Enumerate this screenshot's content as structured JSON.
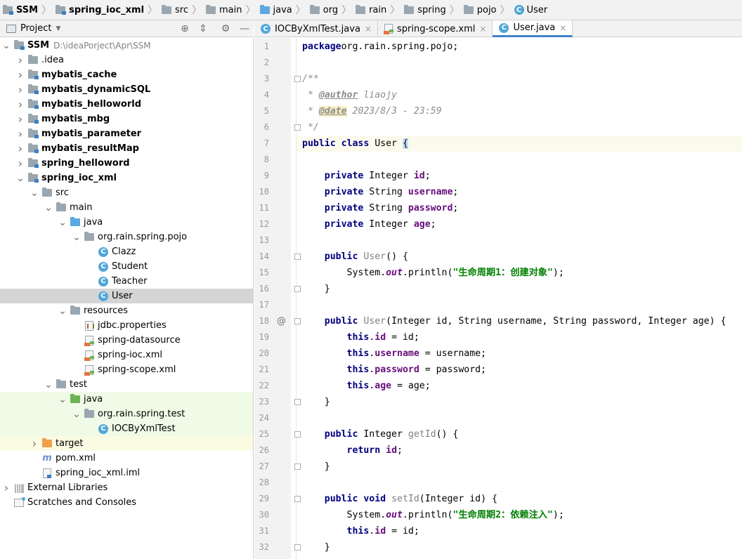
{
  "breadcrumb": [
    {
      "label": "SSM",
      "icon": "module-folder-icon",
      "bold": true
    },
    {
      "label": "spring_ioc_xml",
      "icon": "module-folder-icon",
      "bold": true
    },
    {
      "label": "src",
      "icon": "folder-icon",
      "bold": false
    },
    {
      "label": "main",
      "icon": "folder-icon",
      "bold": false
    },
    {
      "label": "java",
      "icon": "source-folder-icon",
      "bold": false
    },
    {
      "label": "org",
      "icon": "package-icon",
      "bold": false
    },
    {
      "label": "rain",
      "icon": "package-icon",
      "bold": false
    },
    {
      "label": "spring",
      "icon": "package-icon",
      "bold": false
    },
    {
      "label": "pojo",
      "icon": "package-icon",
      "bold": false
    },
    {
      "label": "User",
      "icon": "class-icon",
      "bold": false
    }
  ],
  "project_panel": {
    "title": "Project",
    "tree": [
      {
        "depth": 0,
        "label": "SSM",
        "hint": "D:\\ideaPorject\\Apr\\SSM",
        "icon": "module",
        "arrow": "down",
        "bold": true
      },
      {
        "depth": 1,
        "label": ".idea",
        "icon": "folder",
        "arrow": "right",
        "bold": false
      },
      {
        "depth": 1,
        "label": "mybatis_cache",
        "icon": "module",
        "arrow": "right",
        "bold": true
      },
      {
        "depth": 1,
        "label": "mybatis_dynamicSQL",
        "icon": "module",
        "arrow": "right",
        "bold": true
      },
      {
        "depth": 1,
        "label": "mybatis_helloworld",
        "icon": "module",
        "arrow": "right",
        "bold": true
      },
      {
        "depth": 1,
        "label": "mybatis_mbg",
        "icon": "module",
        "arrow": "right",
        "bold": true
      },
      {
        "depth": 1,
        "label": "mybatis_parameter",
        "icon": "module",
        "arrow": "right",
        "bold": true
      },
      {
        "depth": 1,
        "label": "mybatis_resultMap",
        "icon": "module",
        "arrow": "right",
        "bold": true
      },
      {
        "depth": 1,
        "label": "spring_helloword",
        "icon": "module",
        "arrow": "right",
        "bold": true
      },
      {
        "depth": 1,
        "label": "spring_ioc_xml",
        "icon": "module",
        "arrow": "down",
        "bold": true
      },
      {
        "depth": 2,
        "label": "src",
        "icon": "folder",
        "arrow": "down",
        "bold": false
      },
      {
        "depth": 3,
        "label": "main",
        "icon": "folder",
        "arrow": "down",
        "bold": false
      },
      {
        "depth": 4,
        "label": "java",
        "icon": "source",
        "arrow": "down",
        "bold": false
      },
      {
        "depth": 5,
        "label": "org.rain.spring.pojo",
        "icon": "package",
        "arrow": "down",
        "bold": false
      },
      {
        "depth": 6,
        "label": "Clazz",
        "icon": "class",
        "arrow": "",
        "bold": false
      },
      {
        "depth": 6,
        "label": "Student",
        "icon": "class",
        "arrow": "",
        "bold": false
      },
      {
        "depth": 6,
        "label": "Teacher",
        "icon": "class",
        "arrow": "",
        "bold": false
      },
      {
        "depth": 6,
        "label": "User",
        "icon": "class",
        "arrow": "",
        "bold": false,
        "selected": true
      },
      {
        "depth": 4,
        "label": "resources",
        "icon": "resources",
        "arrow": "down",
        "bold": false
      },
      {
        "depth": 5,
        "label": "jdbc.properties",
        "icon": "prop",
        "arrow": "",
        "bold": false
      },
      {
        "depth": 5,
        "label": "spring-datasource",
        "icon": "xml",
        "arrow": "",
        "bold": false
      },
      {
        "depth": 5,
        "label": "spring-ioc.xml",
        "icon": "xml",
        "arrow": "",
        "bold": false
      },
      {
        "depth": 5,
        "label": "spring-scope.xml",
        "icon": "xml",
        "arrow": "",
        "bold": false
      },
      {
        "depth": 3,
        "label": "test",
        "icon": "folder",
        "arrow": "down",
        "bold": false
      },
      {
        "depth": 4,
        "label": "java",
        "icon": "testsource",
        "arrow": "down",
        "bold": false,
        "test": true
      },
      {
        "depth": 5,
        "label": "org.rain.spring.test",
        "icon": "package",
        "arrow": "down",
        "bold": false,
        "test": true
      },
      {
        "depth": 6,
        "label": "IOCByXmlTest",
        "icon": "class",
        "arrow": "",
        "bold": false,
        "test": true
      },
      {
        "depth": 2,
        "label": "target",
        "icon": "excluded",
        "arrow": "right",
        "bold": false,
        "excluded": true
      },
      {
        "depth": 2,
        "label": "pom.xml",
        "icon": "maven",
        "arrow": "",
        "bold": false
      },
      {
        "depth": 2,
        "label": "spring_ioc_xml.iml",
        "icon": "iml",
        "arrow": "",
        "bold": false
      },
      {
        "depth": 0,
        "label": "External Libraries",
        "icon": "library",
        "arrow": "right",
        "bold": false
      },
      {
        "depth": 0,
        "label": "Scratches and Consoles",
        "icon": "scratch",
        "arrow": "",
        "bold": false
      }
    ]
  },
  "tabs": [
    {
      "label": "IOCByXmlTest.java",
      "icon": "class-icon",
      "active": false
    },
    {
      "label": "spring-scope.xml",
      "icon": "xml-file-icon",
      "active": false
    },
    {
      "label": "User.java",
      "icon": "class-icon",
      "active": true
    }
  ],
  "editor": {
    "current_line": 7,
    "lines": [
      {
        "n": "1",
        "tokens": [
          [
            "kw",
            "package"
          ],
          [
            "",
            "org.rain.spring.pojo;"
          ]
        ]
      },
      {
        "n": "2",
        "tokens": []
      },
      {
        "n": "3",
        "tokens": [
          [
            "cm",
            "/**"
          ]
        ],
        "fold": true
      },
      {
        "n": "4",
        "tokens": [
          [
            "cm",
            " * "
          ],
          [
            "tag",
            "@author"
          ],
          [
            "cm",
            " liaojy"
          ]
        ]
      },
      {
        "n": "5",
        "tokens": [
          [
            "cm",
            " * "
          ],
          [
            "tagdate",
            "@date"
          ],
          [
            "cm",
            " 2023/8/3 - 23:59"
          ]
        ]
      },
      {
        "n": "6",
        "tokens": [
          [
            "cm",
            " */"
          ]
        ],
        "fold": true
      },
      {
        "n": "7",
        "tokens": [
          [
            "kw",
            "public"
          ],
          [
            "",
            " "
          ],
          [
            "kw",
            "class"
          ],
          [
            "",
            " User "
          ],
          [
            "brace",
            "{"
          ]
        ]
      },
      {
        "n": "8",
        "tokens": []
      },
      {
        "n": "9",
        "tokens": [
          [
            "",
            "    "
          ],
          [
            "kw",
            "private"
          ],
          [
            "",
            " Integer "
          ],
          [
            "fld",
            "id"
          ],
          [
            "",
            ";"
          ]
        ]
      },
      {
        "n": "10",
        "tokens": [
          [
            "",
            "    "
          ],
          [
            "kw",
            "private"
          ],
          [
            "",
            " String "
          ],
          [
            "fld",
            "username"
          ],
          [
            "",
            ";"
          ]
        ]
      },
      {
        "n": "11",
        "tokens": [
          [
            "",
            "    "
          ],
          [
            "kw",
            "private"
          ],
          [
            "",
            " String "
          ],
          [
            "fld",
            "password"
          ],
          [
            "",
            ";"
          ]
        ]
      },
      {
        "n": "12",
        "tokens": [
          [
            "",
            "    "
          ],
          [
            "kw",
            "private"
          ],
          [
            "",
            " Integer "
          ],
          [
            "fld",
            "age"
          ],
          [
            "",
            ";"
          ]
        ]
      },
      {
        "n": "13",
        "tokens": []
      },
      {
        "n": "14",
        "tokens": [
          [
            "",
            "    "
          ],
          [
            "kw",
            "public"
          ],
          [
            "",
            " "
          ],
          [
            "mth",
            "User"
          ],
          [
            "",
            "() {"
          ]
        ],
        "fold": true
      },
      {
        "n": "15",
        "tokens": [
          [
            "",
            "        System."
          ],
          [
            "stat",
            "out"
          ],
          [
            "",
            ".println("
          ],
          [
            "str",
            "\"生命周期1：创建对象\""
          ],
          [
            "",
            ");"
          ]
        ]
      },
      {
        "n": "16",
        "tokens": [
          [
            "",
            "    }"
          ]
        ],
        "fold": true
      },
      {
        "n": "17",
        "tokens": []
      },
      {
        "n": "18",
        "tokens": [
          [
            "",
            "    "
          ],
          [
            "kw",
            "public"
          ],
          [
            "",
            " "
          ],
          [
            "mth",
            "User"
          ],
          [
            "",
            "(Integer id, String username, String password, Integer age) {"
          ]
        ],
        "fold": true,
        "mark": "@"
      },
      {
        "n": "19",
        "tokens": [
          [
            "",
            "        "
          ],
          [
            "kw",
            "this"
          ],
          [
            "",
            "."
          ],
          [
            "fld",
            "id"
          ],
          [
            "",
            " = id;"
          ]
        ]
      },
      {
        "n": "20",
        "tokens": [
          [
            "",
            "        "
          ],
          [
            "kw",
            "this"
          ],
          [
            "",
            "."
          ],
          [
            "fld",
            "username"
          ],
          [
            "",
            " = username;"
          ]
        ]
      },
      {
        "n": "21",
        "tokens": [
          [
            "",
            "        "
          ],
          [
            "kw",
            "this"
          ],
          [
            "",
            "."
          ],
          [
            "fld",
            "password"
          ],
          [
            "",
            " = password;"
          ]
        ]
      },
      {
        "n": "22",
        "tokens": [
          [
            "",
            "        "
          ],
          [
            "kw",
            "this"
          ],
          [
            "",
            "."
          ],
          [
            "fld",
            "age"
          ],
          [
            "",
            " = age;"
          ]
        ]
      },
      {
        "n": "23",
        "tokens": [
          [
            "",
            "    }"
          ]
        ],
        "fold": true
      },
      {
        "n": "24",
        "tokens": []
      },
      {
        "n": "25",
        "tokens": [
          [
            "",
            "    "
          ],
          [
            "kw",
            "public"
          ],
          [
            "",
            " Integer "
          ],
          [
            "mth",
            "getId"
          ],
          [
            "",
            "() {"
          ]
        ],
        "fold": true
      },
      {
        "n": "26",
        "tokens": [
          [
            "",
            "        "
          ],
          [
            "kw",
            "return"
          ],
          [
            "",
            " "
          ],
          [
            "fld",
            "id"
          ],
          [
            "",
            ";"
          ]
        ]
      },
      {
        "n": "27",
        "tokens": [
          [
            "",
            "    }"
          ]
        ],
        "fold": true
      },
      {
        "n": "28",
        "tokens": []
      },
      {
        "n": "29",
        "tokens": [
          [
            "",
            "    "
          ],
          [
            "kw",
            "public"
          ],
          [
            "",
            " "
          ],
          [
            "kw",
            "void"
          ],
          [
            "",
            " "
          ],
          [
            "mth",
            "setId"
          ],
          [
            "",
            "(Integer id) {"
          ]
        ],
        "fold": true
      },
      {
        "n": "30",
        "tokens": [
          [
            "",
            "        System."
          ],
          [
            "stat",
            "out"
          ],
          [
            "",
            ".println("
          ],
          [
            "str",
            "\"生命周期2：依赖注入\""
          ],
          [
            "",
            ");"
          ]
        ]
      },
      {
        "n": "31",
        "tokens": [
          [
            "",
            "        "
          ],
          [
            "kw",
            "this"
          ],
          [
            "",
            "."
          ],
          [
            "fld",
            "id"
          ],
          [
            "",
            " = id;"
          ]
        ]
      },
      {
        "n": "32",
        "tokens": [
          [
            "",
            "    }"
          ]
        ],
        "fold": true
      }
    ]
  }
}
